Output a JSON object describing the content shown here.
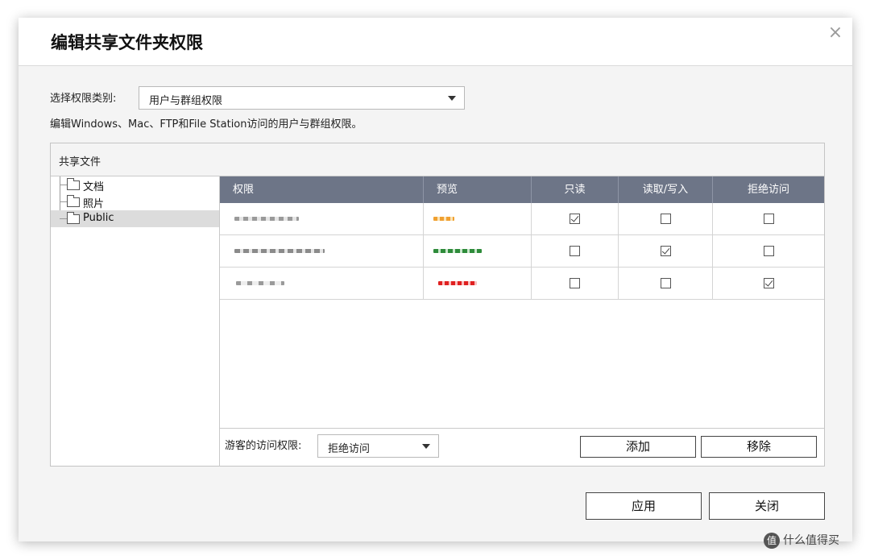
{
  "dialog": {
    "title": "编辑共享文件夹权限",
    "close_symbol": "×",
    "permission_type_label": "选择权限类别:",
    "permission_type_value": "用户与群组权限",
    "description": "编辑Windows、Mac、FTP和File Station访问的用户与群组权限。"
  },
  "panel": {
    "header": "共享文件",
    "tree": [
      {
        "label": "文档",
        "selected": false
      },
      {
        "label": "照片",
        "selected": false
      },
      {
        "label": "Public",
        "selected": true
      }
    ],
    "columns": [
      "权限",
      "预览",
      "只读",
      "读取/写入",
      "拒绝访问"
    ],
    "rows": [
      {
        "read_only": true,
        "read_write": false,
        "deny": false,
        "preview_color": "#f0a030"
      },
      {
        "read_only": false,
        "read_write": true,
        "deny": false,
        "preview_color": "#2e8b3a"
      },
      {
        "read_only": false,
        "read_write": false,
        "deny": true,
        "preview_color": "#e02020"
      }
    ],
    "guest_label": "游客的访问权限:",
    "guest_value": "拒绝访问",
    "add_label": "添加",
    "remove_label": "移除"
  },
  "footer": {
    "apply_label": "应用",
    "close_label": "关闭"
  },
  "watermark": {
    "icon_text": "值",
    "text": "什么值得买"
  },
  "colors": {
    "header_bg": "#6d7587",
    "selected_tree_bg": "#dcdcdc"
  }
}
